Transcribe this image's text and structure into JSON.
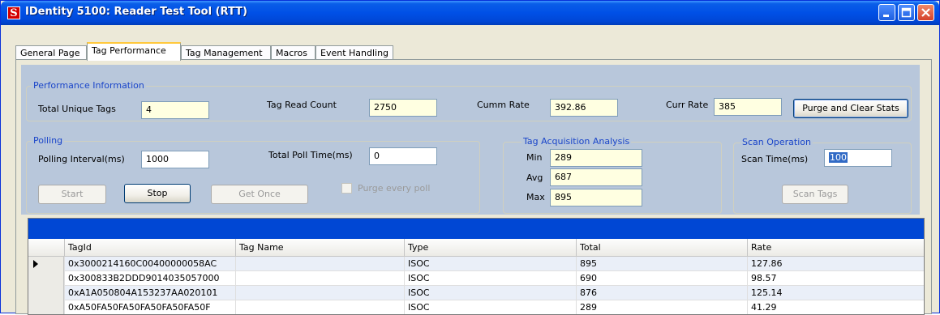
{
  "window": {
    "title": "IDentity 5100: Reader Test Tool (RTT)",
    "icon_letter": "S"
  },
  "tabs": [
    {
      "label": "General Page"
    },
    {
      "label": "Tag Performance",
      "active": true
    },
    {
      "label": "Tag Management"
    },
    {
      "label": "Macros"
    },
    {
      "label": "Event Handling"
    }
  ],
  "performance": {
    "group_title": "Performance Information",
    "total_unique_tags_label": "Total Unique Tags",
    "total_unique_tags": "4",
    "tag_read_count_label": "Tag Read Count",
    "tag_read_count": "2750",
    "cumm_rate_label": "Cumm Rate",
    "cumm_rate": "392.86",
    "curr_rate_label": "Curr Rate",
    "curr_rate": "385",
    "purge_button": "Purge and Clear Stats"
  },
  "polling": {
    "group_title": "Polling",
    "interval_label": "Polling Interval(ms)",
    "interval": "1000",
    "total_poll_time_label": "Total Poll Time(ms)",
    "total_poll_time": "0",
    "start_button": "Start",
    "stop_button": "Stop",
    "get_once_button": "Get Once",
    "purge_every_poll_label": "Purge every poll"
  },
  "acquisition": {
    "group_title": "Tag Acquisition Analysis",
    "min_label": "Min",
    "min": "289",
    "avg_label": "Avg",
    "avg": "687",
    "max_label": "Max",
    "max": "895"
  },
  "scan": {
    "group_title": "Scan Operation",
    "scan_time_label": "Scan Time(ms)",
    "scan_time": "100",
    "scan_button": "Scan Tags"
  },
  "grid": {
    "columns": [
      "TagId",
      "Tag Name",
      "Type",
      "Total",
      "Rate"
    ],
    "rows": [
      {
        "tagid": "0x3000214160C00400000058AC",
        "name": "",
        "type": "ISOC",
        "total": "895",
        "rate": "127.86"
      },
      {
        "tagid": "0x300833B2DDD9014035057000",
        "name": "",
        "type": "ISOC",
        "total": "690",
        "rate": "98.57"
      },
      {
        "tagid": "0xA1A050804A153237AA020101",
        "name": "",
        "type": "ISOC",
        "total": "876",
        "rate": "125.14"
      },
      {
        "tagid": "0xA50FA50FA50FA50FA50FA50F",
        "name": "",
        "type": "ISOC",
        "total": "289",
        "rate": "41.29"
      }
    ]
  },
  "colors": {
    "title_bar": "#0050e6",
    "group_title": "#1a45c9",
    "panel": "#b8c7db",
    "grid_caption": "#0047d4",
    "field_bg": "#ffffe1"
  },
  "icons": [
    "app-logo-icon",
    "minimize-icon",
    "maximize-icon",
    "close-icon",
    "current-row-arrow-icon"
  ]
}
